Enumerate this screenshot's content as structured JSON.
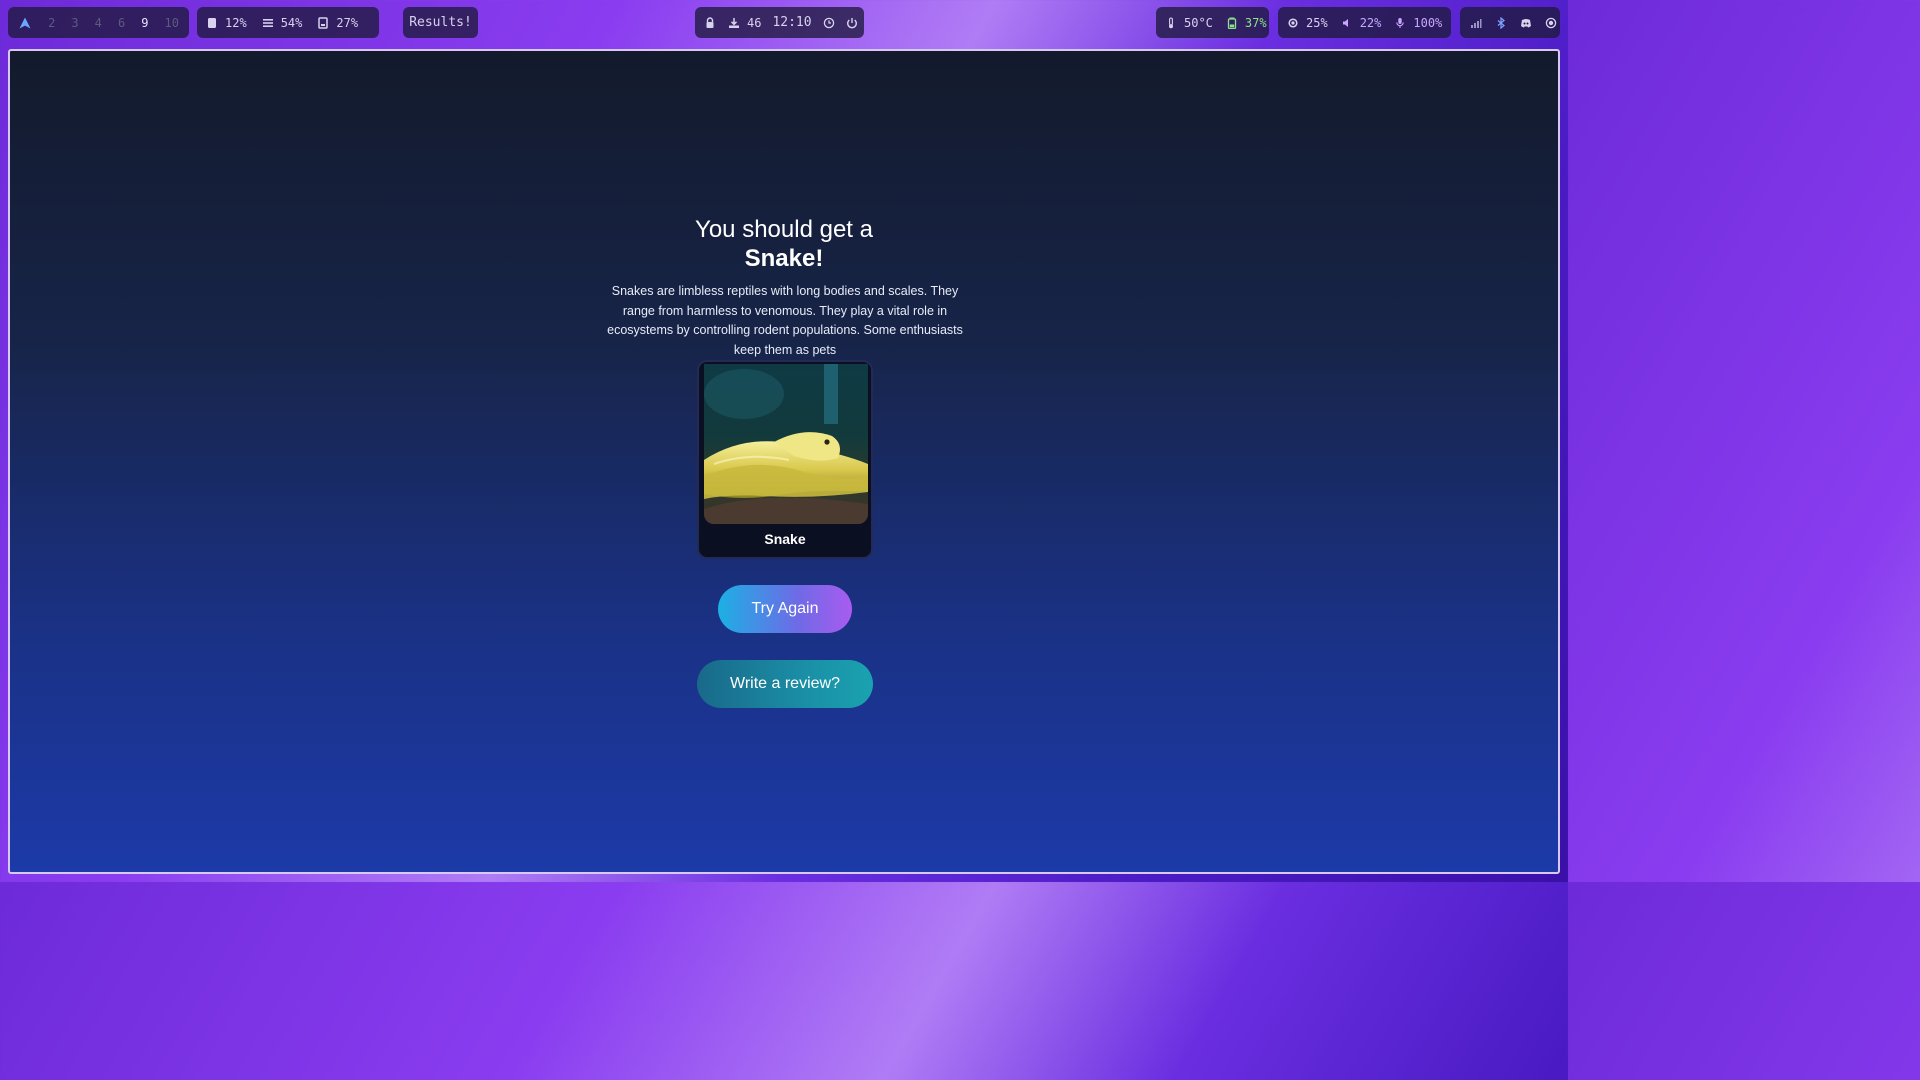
{
  "topbar": {
    "workspaces": [
      {
        "label": "2"
      },
      {
        "label": "3"
      },
      {
        "label": "4"
      },
      {
        "label": "6"
      },
      {
        "label": "9"
      },
      {
        "label": "10"
      }
    ],
    "stats": {
      "cpu": "12%",
      "memory": "54%",
      "disk": "27%"
    },
    "window_title": "Results!",
    "center": {
      "updates": "46",
      "clock": "12:10"
    },
    "sensors": {
      "temperature": "50°C",
      "battery": "37%"
    },
    "levels": {
      "brightness": "25%",
      "volume": "22%",
      "microphone": "100%"
    }
  },
  "page": {
    "heading_line1": "You should get a",
    "heading_line2": "Snake!",
    "description": "Snakes are limbless reptiles with long bodies and scales. They range from harmless to venomous. They play a vital role in ecosystems by controlling rodent populations. Some enthusiasts keep them as pets",
    "card_caption": "Snake",
    "try_again_label": "Try Again",
    "review_label": "Write a review?"
  },
  "colors": {
    "accent_green": "#8be28b",
    "accent_purple": "#c9a7ff",
    "button_gradient_start": "#1cb0e4",
    "button_gradient_end": "#a95bf0",
    "review_button": "#1a8ea5"
  }
}
